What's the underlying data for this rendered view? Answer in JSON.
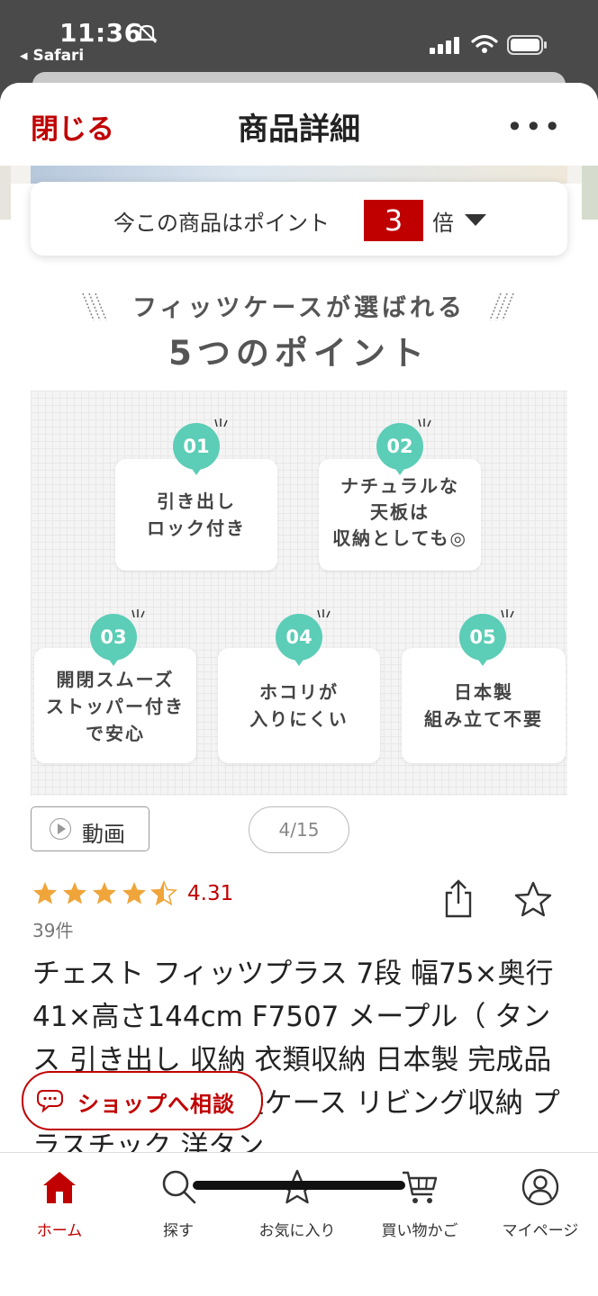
{
  "status_bar": {
    "time": "11:36",
    "back_app": "Safari"
  },
  "header": {
    "close_label": "閉じる",
    "title": "商品詳細",
    "more_label": "•••"
  },
  "points_banner": {
    "prefix": "今この商品はポイント",
    "multiplier": "3",
    "suffix": "倍"
  },
  "product_image": {
    "heading_line1": "フィッツケースが選ばれる",
    "heading_line2": "5つのポイント",
    "badge_color": "#5ccdb6",
    "points": [
      {
        "badge": "01",
        "text": "引き出し\nロック付き"
      },
      {
        "badge": "02",
        "text": "ナチュラルな\n天板は\n収納としても◎"
      },
      {
        "badge": "03",
        "text": "開閉スムーズ\nストッパー付き\nで安心"
      },
      {
        "badge": "04",
        "text": "ホコリが\n入りにくい"
      },
      {
        "badge": "05",
        "text": "日本製\n組み立て不要"
      }
    ]
  },
  "video_button": {
    "label": "動画",
    "icon": "play-icon"
  },
  "pagination": {
    "text": "4/15"
  },
  "rating": {
    "value": 4.31,
    "display": "4.31",
    "stars": 4.5,
    "reviews": "39件"
  },
  "product": {
    "title": "チェスト フィッツプラス 7段 幅75×奥行41×高さ144cm F7507 メープル（ タンス 引き出し 収納 衣類収納 日本製 完成品 フィッツ Fits 衣装ケース リビング収納 プラスチック 洋タン"
  },
  "consult_button": {
    "label": "ショップへ相談"
  },
  "tabbar": {
    "items": [
      {
        "label": "ホーム",
        "icon": "home-icon",
        "active": true
      },
      {
        "label": "探す",
        "icon": "search-icon",
        "active": false
      },
      {
        "label": "お気に入り",
        "icon": "star-icon",
        "active": false
      },
      {
        "label": "買い物かご",
        "icon": "cart-icon",
        "active": false
      },
      {
        "label": "マイページ",
        "icon": "user-icon",
        "active": false
      }
    ]
  },
  "colors": {
    "accent": "#c00000",
    "star": "#f0a53a"
  }
}
